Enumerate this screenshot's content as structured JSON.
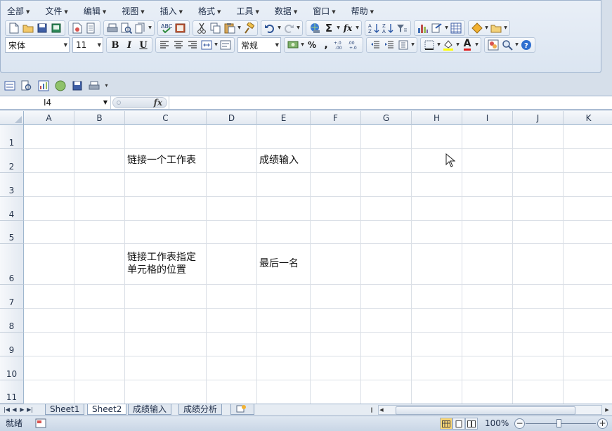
{
  "menubar": {
    "items": [
      {
        "label": "全部"
      },
      {
        "label": "文件"
      },
      {
        "label": "编辑"
      },
      {
        "label": "视图"
      },
      {
        "label": "插入"
      },
      {
        "label": "格式"
      },
      {
        "label": "工具"
      },
      {
        "label": "数据"
      },
      {
        "label": "窗口"
      },
      {
        "label": "帮助"
      }
    ]
  },
  "toolbar": {
    "font_name": "宋体",
    "font_size": "11",
    "bold": "B",
    "italic": "I",
    "underline": "U",
    "number_format": "常规",
    "percent": "%",
    "comma": ",",
    "sum": "Σ",
    "fx": "fx",
    "font_color": "A"
  },
  "formula_bar": {
    "name_box": "I4",
    "fx_label": "fx",
    "formula": ""
  },
  "sheet": {
    "columns": [
      "A",
      "B",
      "C",
      "D",
      "E",
      "F",
      "G",
      "H",
      "I",
      "J",
      "K"
    ],
    "rows": [
      "1",
      "2",
      "3",
      "4",
      "5",
      "6",
      "7",
      "8",
      "9",
      "10",
      "11"
    ],
    "cells": {
      "C2": "链接一个工作表",
      "E2": "成绩输入",
      "C6_line1": "链接工作表指定",
      "C6_line2": "单元格的位置",
      "E6": "最后一名"
    }
  },
  "tabs": [
    "Sheet1",
    "Sheet2",
    "成绩输入",
    "成绩分析"
  ],
  "active_tab": "Sheet2",
  "status": {
    "ready": "就绪",
    "zoom": "100%"
  },
  "colors": {
    "accent": "#fbd774",
    "grid_line": "#dadfe6",
    "header_bg": "#e3e9f1"
  }
}
